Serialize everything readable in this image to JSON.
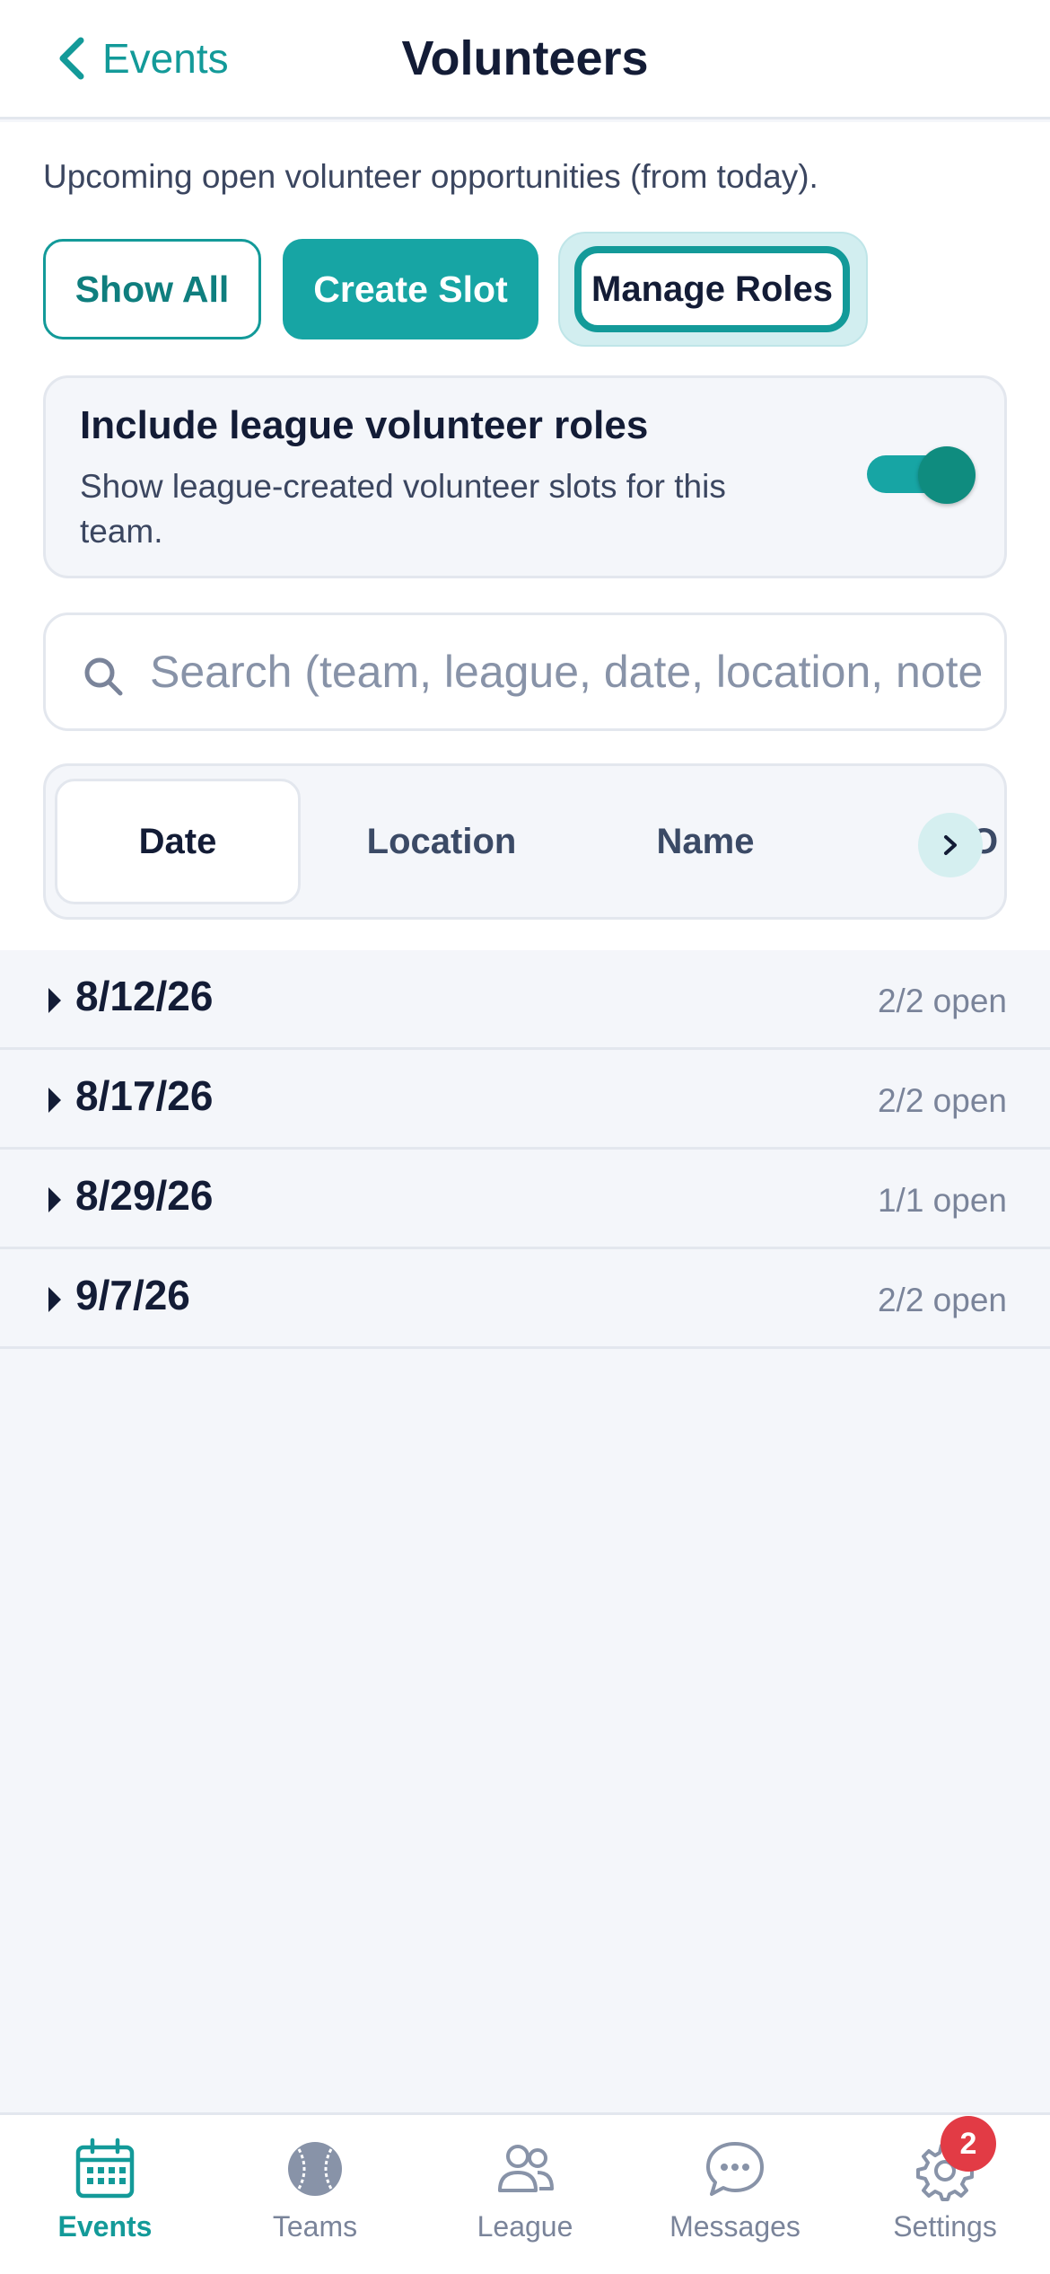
{
  "header": {
    "back_label": "Events",
    "title": "Volunteers"
  },
  "intro": "Upcoming open volunteer opportunities (from today).",
  "actions": {
    "show_all": "Show All",
    "create_slot": "Create Slot",
    "manage_roles": "Manage Roles"
  },
  "league_toggle": {
    "title": "Include league volunteer roles",
    "description": "Show league-created volunteer slots for this team.",
    "enabled": true
  },
  "search": {
    "placeholder": "Search (team, league, date, location, notes)"
  },
  "sort": {
    "tabs": [
      {
        "label": "Date",
        "active": true
      },
      {
        "label": "Location",
        "active": false
      },
      {
        "label": "Name",
        "active": false
      }
    ],
    "overflow_label": "O"
  },
  "dates": [
    {
      "date": "8/12/26",
      "count": "2/2 open"
    },
    {
      "date": "8/17/26",
      "count": "2/2 open"
    },
    {
      "date": "8/29/26",
      "count": "1/1 open"
    },
    {
      "date": "9/7/26",
      "count": "2/2 open"
    }
  ],
  "tab_bar": {
    "items": [
      {
        "label": "Events",
        "icon": "calendar-icon",
        "active": true
      },
      {
        "label": "Teams",
        "icon": "baseball-icon",
        "active": false
      },
      {
        "label": "League",
        "icon": "people-icon",
        "active": false
      },
      {
        "label": "Messages",
        "icon": "chat-bubble-icon",
        "active": false
      },
      {
        "label": "Settings",
        "icon": "gear-icon",
        "active": false
      }
    ],
    "settings_badge": "2"
  },
  "colors": {
    "accent": "#17a5a4",
    "accent_dark": "#139a99",
    "badge": "#e23b45",
    "background": "#f4f6fa"
  }
}
